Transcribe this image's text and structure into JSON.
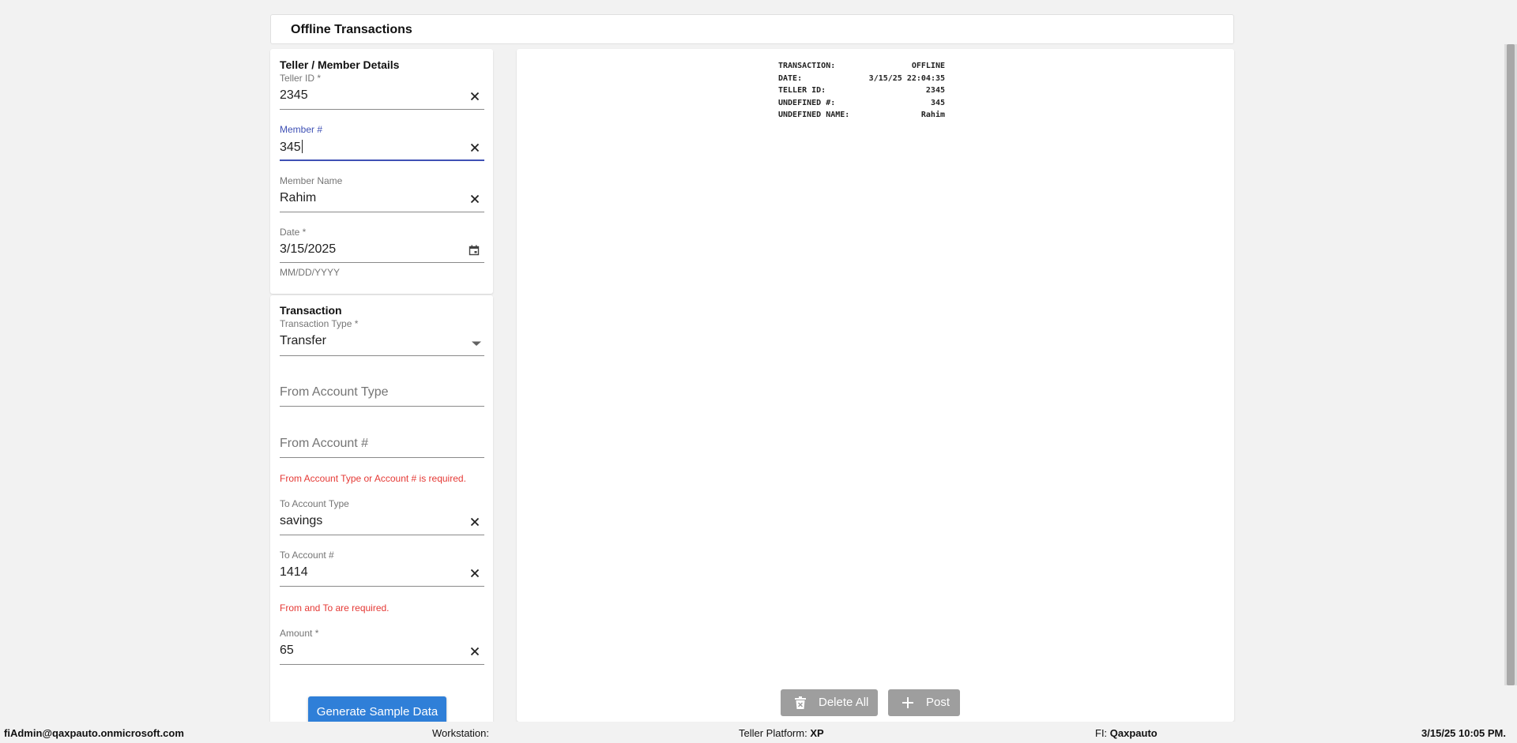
{
  "header": {
    "title": "Offline Transactions"
  },
  "teller": {
    "section_title": "Teller / Member Details",
    "teller_id": {
      "label": "Teller ID *",
      "value": "2345"
    },
    "member_number": {
      "label": "Member #",
      "value": "345"
    },
    "member_name": {
      "label": "Member Name",
      "value": "Rahim"
    },
    "date": {
      "label": "Date *",
      "value": "3/15/2025",
      "helper": "MM/DD/YYYY"
    }
  },
  "transaction": {
    "section_title": "Transaction",
    "type": {
      "label": "Transaction Type *",
      "value": "Transfer"
    },
    "from_account_type": {
      "placeholder": "From Account Type"
    },
    "from_account_number": {
      "placeholder": "From Account #"
    },
    "from_error": "From Account Type or Account # is required.",
    "to_account_type": {
      "label": "To Account Type",
      "value": "savings"
    },
    "to_account_number": {
      "label": "To Account #",
      "value": "1414"
    },
    "to_error": "From and To are required.",
    "amount": {
      "label": "Amount *",
      "value": "65"
    },
    "generate_button": "Generate Sample Data"
  },
  "receipt": {
    "rows": [
      {
        "key": "TRANSACTION:",
        "value": "OFFLINE"
      },
      {
        "key": "DATE:",
        "value": "3/15/25 22:04:35"
      },
      {
        "key": "TELLER ID:",
        "value": "2345"
      },
      {
        "key": "UNDEFINED #:",
        "value": "345"
      },
      {
        "key": "UNDEFINED NAME:",
        "value": "Rahim"
      }
    ]
  },
  "actions": {
    "delete_all": "Delete All",
    "post": "Post"
  },
  "status_bar": {
    "user": "fiAdmin@qaxpauto.onmicrosoft.com",
    "workstation_label": "Workstation:",
    "platform_label": "Teller Platform:",
    "platform_value": "XP",
    "fi_label": "FI:",
    "fi_value": "Qaxpauto",
    "datetime": "3/15/25 10:05 PM."
  },
  "colors": {
    "accent": "#3f51b5",
    "error": "#e53935",
    "primary_button": "#2f7fd8",
    "disabled_button": "#9e9e9e"
  },
  "icons": {
    "clear": "close-icon",
    "calendar": "calendar-icon",
    "dropdown": "dropdown-arrow-icon",
    "delete": "trash-icon",
    "post": "plus-icon"
  }
}
